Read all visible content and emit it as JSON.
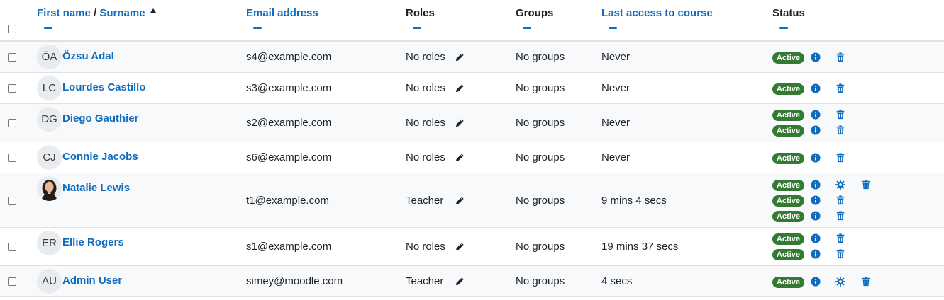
{
  "header": {
    "first_name": "First name",
    "separator": "/",
    "surname": "Surname",
    "email": "Email address",
    "roles": "Roles",
    "groups": "Groups",
    "last_access": "Last access to course",
    "status": "Status"
  },
  "rows": [
    {
      "initials": "ÖA",
      "name": "Özsu Adal",
      "email": "s4@example.com",
      "roles": "No roles",
      "groups": "No groups",
      "last_access": "Never",
      "status": [
        "Active"
      ],
      "manage": false
    },
    {
      "initials": "LC",
      "name": "Lourdes Castillo",
      "email": "s3@example.com",
      "roles": "No roles",
      "groups": "No groups",
      "last_access": "Never",
      "status": [
        "Active"
      ],
      "manage": false
    },
    {
      "initials": "DG",
      "name": "Diego Gauthier",
      "email": "s2@example.com",
      "roles": "No roles",
      "groups": "No groups",
      "last_access": "Never",
      "status": [
        "Active",
        "Active"
      ],
      "manage": false
    },
    {
      "initials": "CJ",
      "name": "Connie Jacobs",
      "email": "s6@example.com",
      "roles": "No roles",
      "groups": "No groups",
      "last_access": "Never",
      "status": [
        "Active"
      ],
      "manage": false
    },
    {
      "initials": "",
      "name": "Natalie Lewis",
      "email": "t1@example.com",
      "roles": "Teacher",
      "groups": "No groups",
      "last_access": "9 mins 4 secs",
      "status": [
        "Active",
        "Active",
        "Active"
      ],
      "manage": true
    },
    {
      "initials": "ER",
      "name": "Ellie Rogers",
      "email": "s1@example.com",
      "roles": "No roles",
      "groups": "No groups",
      "last_access": "19 mins 37 secs",
      "status": [
        "Active",
        "Active"
      ],
      "manage": false
    },
    {
      "initials": "AU",
      "name": "Admin User",
      "email": "simey@moodle.com",
      "roles": "Teacher",
      "groups": "No groups",
      "last_access": "4 secs",
      "status": [
        "Active"
      ],
      "manage": true
    }
  ],
  "colors": {
    "link": "#0f6cbf",
    "active_badge": "#357a32",
    "row_alt": "#f8f9fa",
    "border": "#dee2e6"
  },
  "icons": {
    "edit": "pencil-icon",
    "info": "info-icon",
    "delete": "trash-icon",
    "settings": "gear-icon",
    "sort": "sort-asc-icon"
  }
}
